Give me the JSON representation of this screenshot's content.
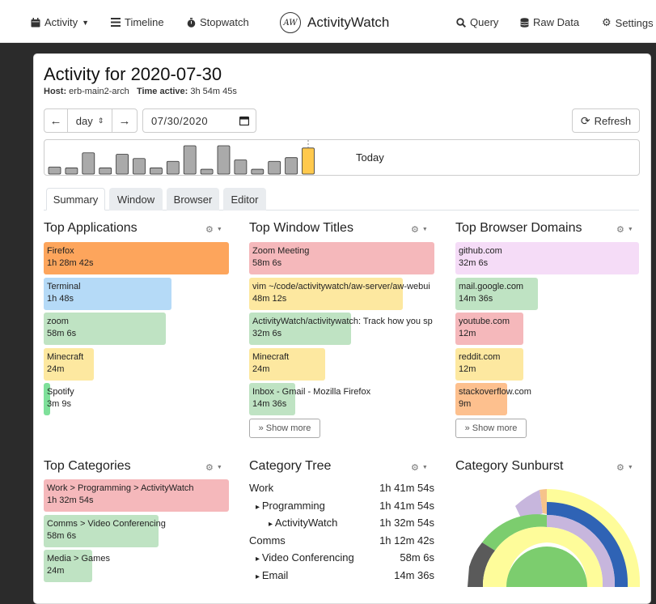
{
  "navbar": {
    "activity": "Activity",
    "timeline": "Timeline",
    "stopwatch": "Stopwatch",
    "brand": "ActivityWatch",
    "brand_logo": "AW",
    "query": "Query",
    "raw_data": "Raw Data",
    "settings": "Settings"
  },
  "page": {
    "title": "Activity for 2020-07-30",
    "host_label": "Host:",
    "host_value": "erb-main2-arch",
    "time_active_label": "Time active:",
    "time_active_value": "3h 54m 45s"
  },
  "controls": {
    "period": "day",
    "date": "07/30/2020",
    "refresh": "Refresh"
  },
  "histogram": {
    "today_label": "Today",
    "values": [
      0.25,
      0.22,
      0.75,
      0.22,
      0.7,
      0.55,
      0.22,
      0.45,
      1.0,
      0.17,
      1.0,
      0.5,
      0.17,
      0.45,
      0.58,
      0.92
    ],
    "highlight_index": 15,
    "bar_color": "#aaaaaa",
    "highlight_color": "#ffc94d"
  },
  "tabs": [
    "Summary",
    "Window",
    "Browser",
    "Editor"
  ],
  "active_tab": "Summary",
  "top_applications": {
    "title": "Top Applications",
    "items": [
      {
        "name": "Firefox",
        "duration": "1h 28m 42s",
        "fraction": 1.0,
        "color": "#fda55c"
      },
      {
        "name": "Terminal",
        "duration": "1h 48s",
        "fraction": 0.69,
        "color": "#b5daf7"
      },
      {
        "name": "zoom",
        "duration": "58m 6s",
        "fraction": 0.66,
        "color": "#bfe3c3"
      },
      {
        "name": "Minecraft",
        "duration": "24m",
        "fraction": 0.27,
        "color": "#fde8a0"
      },
      {
        "name": "Spotify",
        "duration": "3m 9s",
        "fraction": 0.035,
        "color": "#7ee09a"
      }
    ]
  },
  "top_window_titles": {
    "title": "Top Window Titles",
    "items": [
      {
        "name": "Zoom Meeting",
        "duration": "58m 6s",
        "fraction": 1.0,
        "color": "#f5b8bb"
      },
      {
        "name": "vim ~/code/activitywatch/aw-server/aw-webui",
        "duration": "48m 12s",
        "fraction": 0.83,
        "color": "#fde8a0"
      },
      {
        "name": "ActivityWatch/activitywatch: Track how you spend your time",
        "duration": "32m 6s",
        "fraction": 0.55,
        "color": "#bfe3c3"
      },
      {
        "name": "Minecraft",
        "duration": "24m",
        "fraction": 0.41,
        "color": "#fde8a0"
      },
      {
        "name": "Inbox - Gmail - Mozilla Firefox",
        "duration": "14m 36s",
        "fraction": 0.25,
        "color": "#bfe3c3"
      }
    ],
    "show_more": "Show more"
  },
  "top_browser_domains": {
    "title": "Top Browser Domains",
    "items": [
      {
        "name": "github.com",
        "duration": "32m 6s",
        "fraction": 1.0,
        "color": "#f5dcf7"
      },
      {
        "name": "mail.google.com",
        "duration": "14m 36s",
        "fraction": 0.45,
        "color": "#bfe3c3"
      },
      {
        "name": "youtube.com",
        "duration": "12m",
        "fraction": 0.37,
        "color": "#f5b8bb"
      },
      {
        "name": "reddit.com",
        "duration": "12m",
        "fraction": 0.37,
        "color": "#fde8a0"
      },
      {
        "name": "stackoverflow.com",
        "duration": "9m",
        "fraction": 0.28,
        "color": "#fdc08e"
      }
    ],
    "show_more": "Show more"
  },
  "top_categories": {
    "title": "Top Categories",
    "items": [
      {
        "name": "Work > Programming > ActivityWatch",
        "duration": "1h 32m 54s",
        "fraction": 1.0,
        "color": "#f5b8bb"
      },
      {
        "name": "Comms > Video Conferencing",
        "duration": "58m 6s",
        "fraction": 0.62,
        "color": "#bfe3c3"
      },
      {
        "name": "Media > Games",
        "duration": "24m",
        "fraction": 0.26,
        "color": "#bfe3c3"
      }
    ]
  },
  "category_tree": {
    "title": "Category Tree",
    "rows": [
      {
        "name": "Work",
        "duration": "1h 41m 54s",
        "level": 0
      },
      {
        "name": "Programming",
        "duration": "1h 41m 54s",
        "level": 1
      },
      {
        "name": "ActivityWatch",
        "duration": "1h 32m 54s",
        "level": 2
      },
      {
        "name": "Comms",
        "duration": "1h 12m 42s",
        "level": 0
      },
      {
        "name": "Video Conferencing",
        "duration": "58m 6s",
        "level": 1
      },
      {
        "name": "Email",
        "duration": "14m 36s",
        "level": 1
      }
    ]
  },
  "category_sunburst": {
    "title": "Category Sunburst"
  }
}
